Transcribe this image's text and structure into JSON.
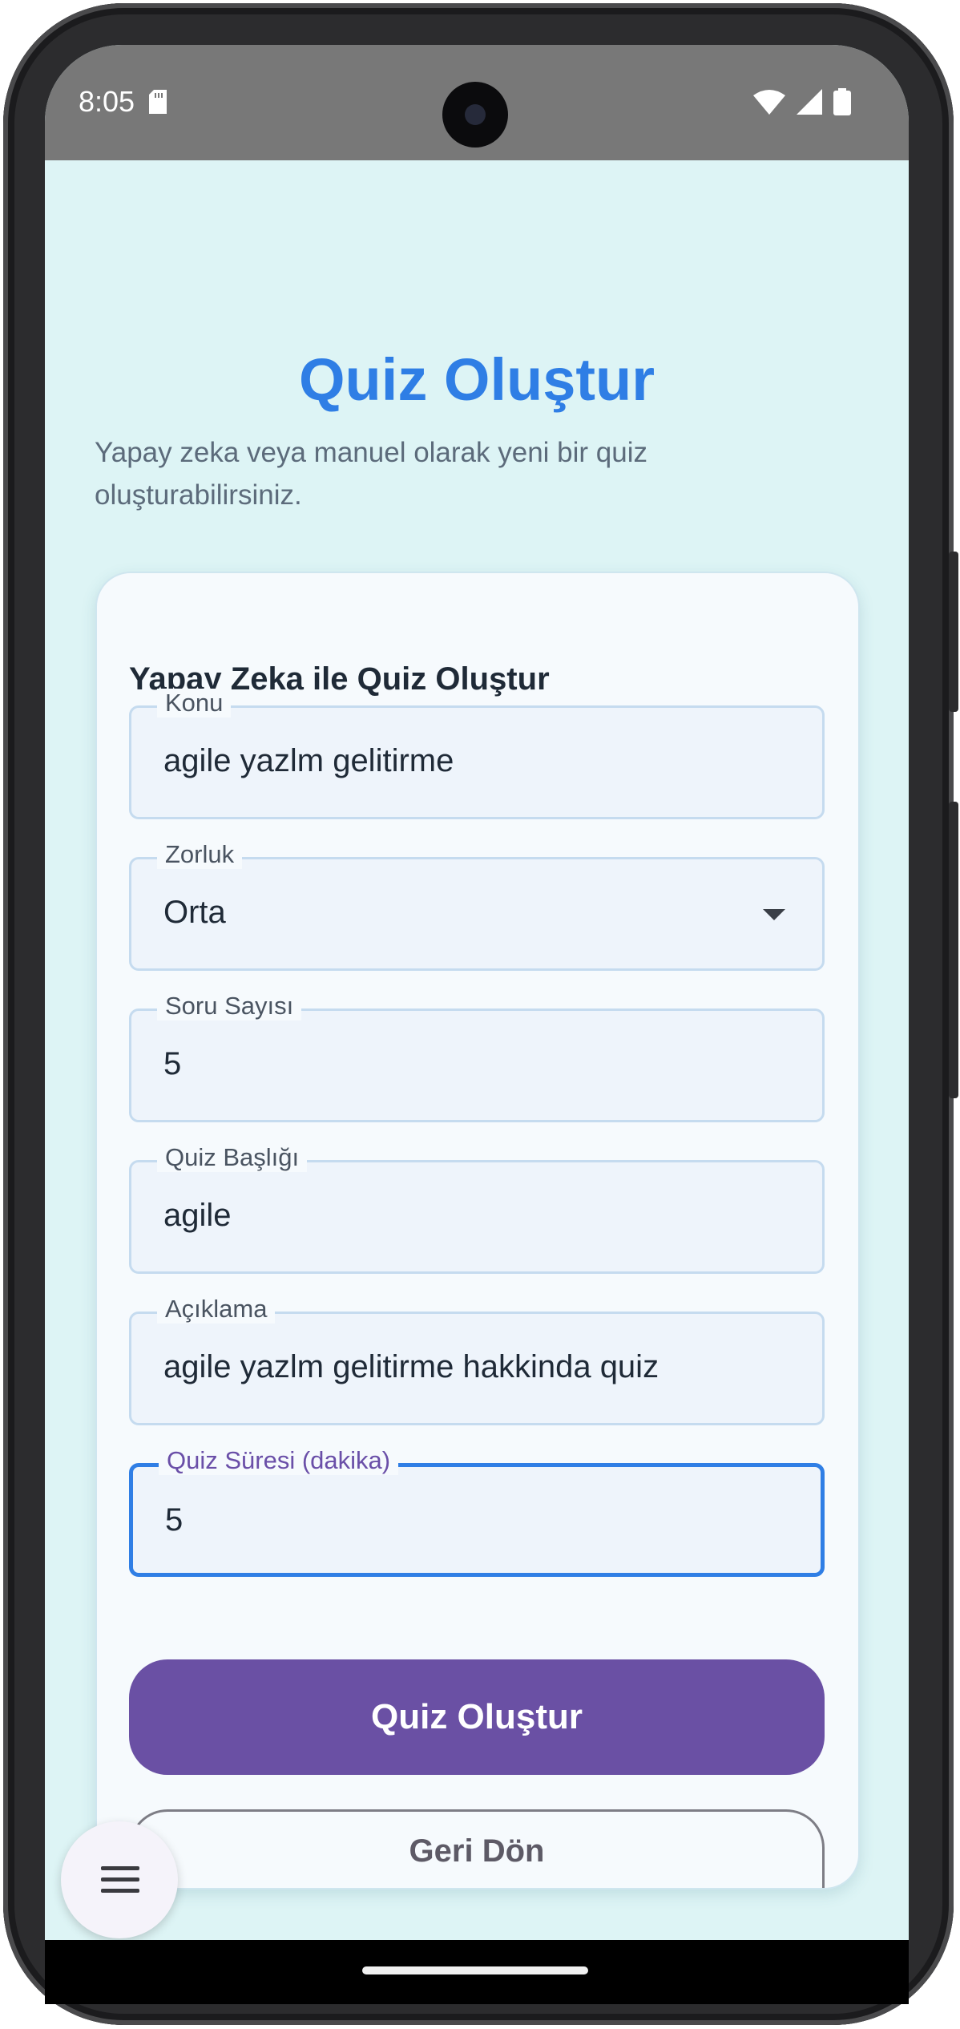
{
  "status_bar": {
    "time": "8:05",
    "icons": [
      "sd-card-icon",
      "wifi-icon",
      "signal-icon",
      "battery-icon"
    ]
  },
  "page": {
    "title": "Quiz Oluştur",
    "subtitle": "Yapay zeka veya manuel olarak yeni bir quiz oluşturabilirsiniz."
  },
  "card": {
    "title": "Yapay Zeka ile Quiz Oluştur",
    "fields": {
      "konu": {
        "label": "Konu",
        "value": "agile yazlm gelitirme"
      },
      "zorluk": {
        "label": "Zorluk",
        "value": "Orta"
      },
      "soru_sayisi": {
        "label": "Soru Sayısı",
        "value": "5"
      },
      "baslik": {
        "label": "Quiz Başlığı",
        "value": "agile"
      },
      "aciklama": {
        "label": "Açıklama",
        "value": "agile yazlm gelitirme hakkinda quiz"
      },
      "sure": {
        "label": "Quiz Süresi (dakika)",
        "value": "5"
      }
    },
    "primary_button": "Quiz Oluştur",
    "secondary_button": "Geri Dön"
  },
  "colors": {
    "accent": "#2f7ee5",
    "primary_button": "#6a50a4",
    "background": "#ddf4f5"
  }
}
